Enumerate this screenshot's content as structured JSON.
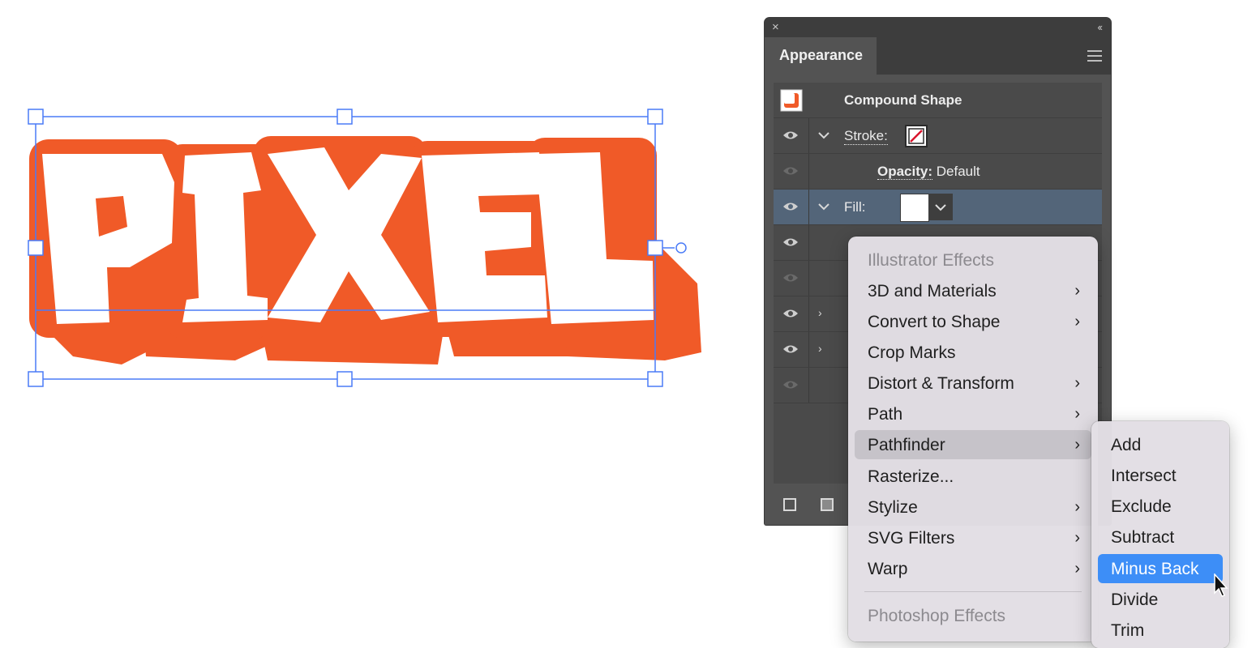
{
  "artwork": {
    "text": "PIXEL",
    "fill_color": "#ffffff",
    "outline_color": "#F05A28",
    "selection_color": "#4A7BF7"
  },
  "panel": {
    "close_icon": "×",
    "collapse_icon": "‹‹",
    "tab_label": "Appearance",
    "object_label": "Compound Shape",
    "rows": {
      "stroke_label": "Stroke:",
      "opacity_key": "Opacity:",
      "opacity_value": "Default",
      "fill_label": "Fill:"
    },
    "row_chevron": "›"
  },
  "effects_menu": {
    "header": "Illustrator Effects",
    "items": [
      {
        "label": "3D and Materials",
        "submenu": true
      },
      {
        "label": "Convert to Shape",
        "submenu": true
      },
      {
        "label": "Crop Marks",
        "submenu": false
      },
      {
        "label": "Distort & Transform",
        "submenu": true
      },
      {
        "label": "Path",
        "submenu": true
      },
      {
        "label": "Pathfinder",
        "submenu": true
      },
      {
        "label": "Rasterize...",
        "submenu": false
      },
      {
        "label": "Stylize",
        "submenu": true
      },
      {
        "label": "SVG Filters",
        "submenu": true
      },
      {
        "label": "Warp",
        "submenu": true
      }
    ],
    "footer_header": "Photoshop Effects",
    "submenu_arrow": "›"
  },
  "pathfinder_menu": {
    "items": [
      "Add",
      "Intersect",
      "Exclude",
      "Subtract",
      "Minus Back",
      "Divide",
      "Trim"
    ]
  }
}
